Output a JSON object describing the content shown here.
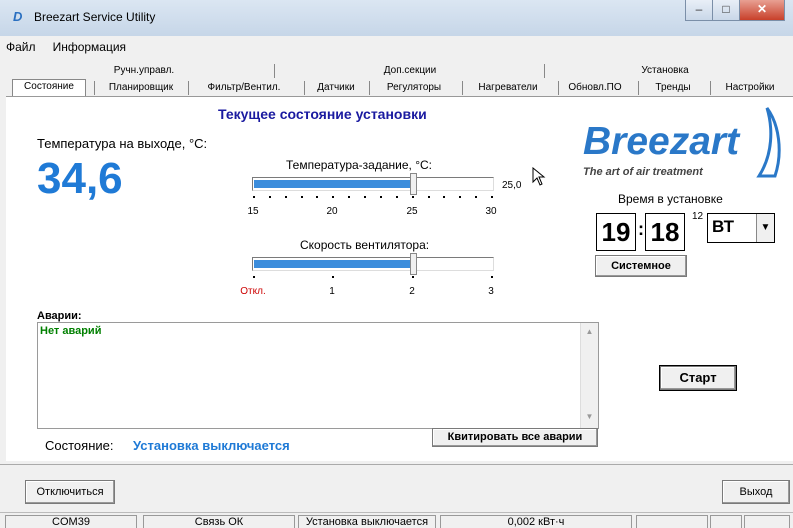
{
  "window": {
    "title": "Breezart Service Utility"
  },
  "menu": [
    "Файл",
    "Информация"
  ],
  "tabs_top": [
    "Ручн.управл.",
    "Доп.секции",
    "Установка"
  ],
  "tabs_bottom": [
    "Состояние",
    "Планировщик",
    "Фильтр/Вентил.",
    "Датчики",
    "Регуляторы",
    "Нагреватели",
    "Обновл.ПО",
    "Тренды",
    "Настройки"
  ],
  "header": {
    "title": "Текущее состояние установки"
  },
  "logo": {
    "name": "Breezart",
    "tagline": "The art of air treatment"
  },
  "outlet": {
    "label": "Температура на выходе, °C:",
    "value": "34,6"
  },
  "setpoint": {
    "label": "Температура-задание, °C:",
    "value": "25,0",
    "min": 15,
    "max": 30,
    "current": 25,
    "ticks": [
      "15",
      "20",
      "25",
      "30"
    ]
  },
  "fan": {
    "label": "Скорость вентилятора:",
    "level": 2,
    "max": 3,
    "ticks": [
      "Откл.",
      "1",
      "2",
      "3"
    ]
  },
  "time": {
    "label": "Время в установке",
    "hours": "19",
    "minutes": "18",
    "seconds": "12",
    "weekday": "ВТ",
    "system_button": "Системное"
  },
  "alarms": {
    "label": "Аварии:",
    "text": "Нет аварий",
    "ack_button": "Квитировать все аварии"
  },
  "start_button": "Старт",
  "state": {
    "label": "Состояние:",
    "value": "Установка выключается"
  },
  "bottom": {
    "disconnect": "Отключиться",
    "exit": "Выход"
  },
  "statusbar": [
    "COM39",
    "Связь ОК",
    "Установка выключается",
    "0,002 кВт·ч"
  ],
  "colors": {
    "accent_blue": "#3c8ddc",
    "text_blue": "#1f7ad6",
    "title_blue": "#1a1aa0",
    "alarm_green": "#008000",
    "off_red": "#cc0000"
  }
}
